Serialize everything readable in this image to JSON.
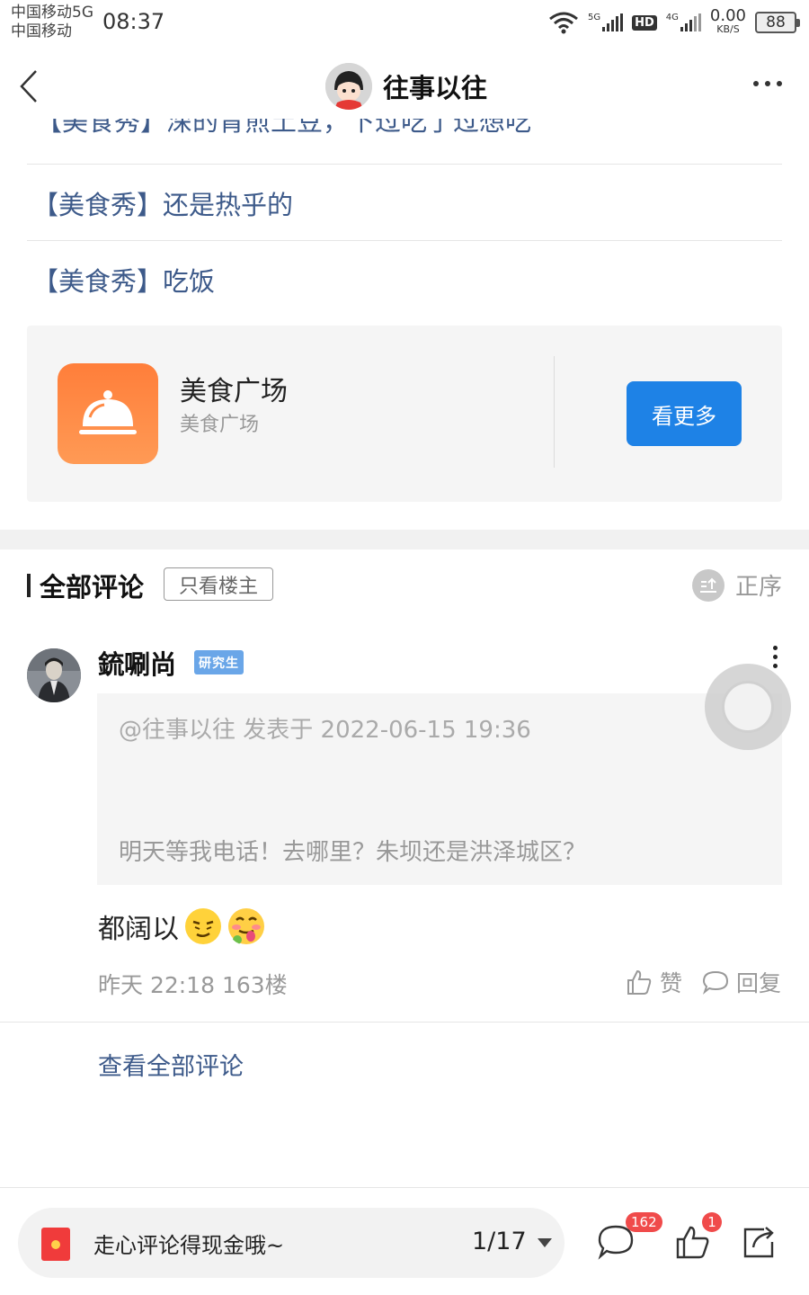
{
  "status_bar": {
    "carrier_1": "中国移动5G",
    "carrier_2": "中国移动",
    "time": "08:37",
    "net_5g": "5G",
    "hd": "HD",
    "net_4g": "4G",
    "speed_value": "0.00",
    "speed_unit": "KB/S",
    "battery": "88"
  },
  "header": {
    "title": "往事以往",
    "back_icon": "chevron-left-icon",
    "more_icon": "more-horizontal-icon"
  },
  "thread_list": {
    "cut_item": "【美食秀】深的青煎土豆，下过吃了过想吃",
    "items": [
      "【美食秀】还是热乎的",
      "【美食秀】吃饭"
    ]
  },
  "forum_card": {
    "name": "美食广场",
    "subtitle": "美食广场",
    "button": "看更多",
    "icon": "food-cloche-icon",
    "accent": "#1e82e6"
  },
  "comments_header": {
    "title": "全部评论",
    "only_host": "只看楼主",
    "sort": "正序"
  },
  "comment": {
    "username": "鋶唰尚",
    "badge": "研究生",
    "quote_meta": "@往事以往 发表于 2022-06-15 19:36",
    "quote_text": "明天等我电话！去哪里？朱坝还是洪泽城区？",
    "text": "都阔以",
    "time_floor": "昨天 22:18  163楼",
    "like_label": "赞",
    "reply_label": "回复"
  },
  "view_all": "查看全部评论",
  "bottom_bar": {
    "placeholder": "走心评论得现金哦~",
    "page_indicator": "1/17",
    "comment_count": "162",
    "like_count": "1",
    "badge_color": "#f04b4b"
  }
}
